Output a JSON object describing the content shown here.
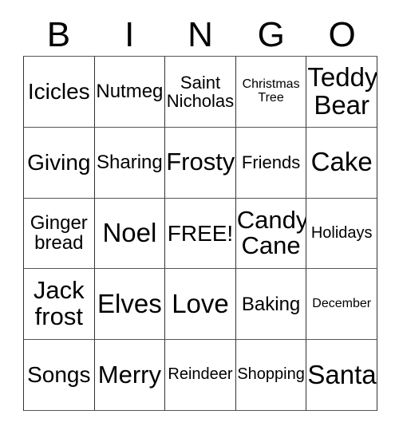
{
  "card": {
    "title_letters": [
      "B",
      "I",
      "N",
      "G",
      "O"
    ],
    "free_space_label": "FREE!",
    "colors": {
      "background": "#ffffff",
      "text": "#000000",
      "grid_line": "#333333"
    },
    "grid": {
      "columns": 5,
      "rows": 5,
      "cells": [
        [
          {
            "label": "Icicles",
            "size": "md"
          },
          {
            "label": "Nutmeg",
            "size": "sm"
          },
          {
            "label": "Saint\nNicholas",
            "size": "xs"
          },
          {
            "label": "Christmas\nTree",
            "size": "tiny"
          },
          {
            "label": "Teddy\nBear",
            "size": "xl"
          }
        ],
        [
          {
            "label": "Giving",
            "size": "md"
          },
          {
            "label": "Sharing",
            "size": "sm"
          },
          {
            "label": "Frosty",
            "size": "lg"
          },
          {
            "label": "Friends",
            "size": "xs"
          },
          {
            "label": "Cake",
            "size": "xl"
          }
        ],
        [
          {
            "label": "Ginger\nbread",
            "size": "sm"
          },
          {
            "label": "Noel",
            "size": "xl"
          },
          {
            "label": "FREE!",
            "size": "md"
          },
          {
            "label": "Candy\nCane",
            "size": "lg"
          },
          {
            "label": "Holidays",
            "size": "xxs"
          }
        ],
        [
          {
            "label": "Jack\nfrost",
            "size": "lg"
          },
          {
            "label": "Elves",
            "size": "xl"
          },
          {
            "label": "Love",
            "size": "xl"
          },
          {
            "label": "Baking",
            "size": "sm"
          },
          {
            "label": "December",
            "size": "tiny"
          }
        ],
        [
          {
            "label": "Songs",
            "size": "md"
          },
          {
            "label": "Merry",
            "size": "lg"
          },
          {
            "label": "Reindeer",
            "size": "xxs"
          },
          {
            "label": "Shopping",
            "size": "xxs"
          },
          {
            "label": "Santa",
            "size": "xl"
          }
        ]
      ]
    }
  }
}
